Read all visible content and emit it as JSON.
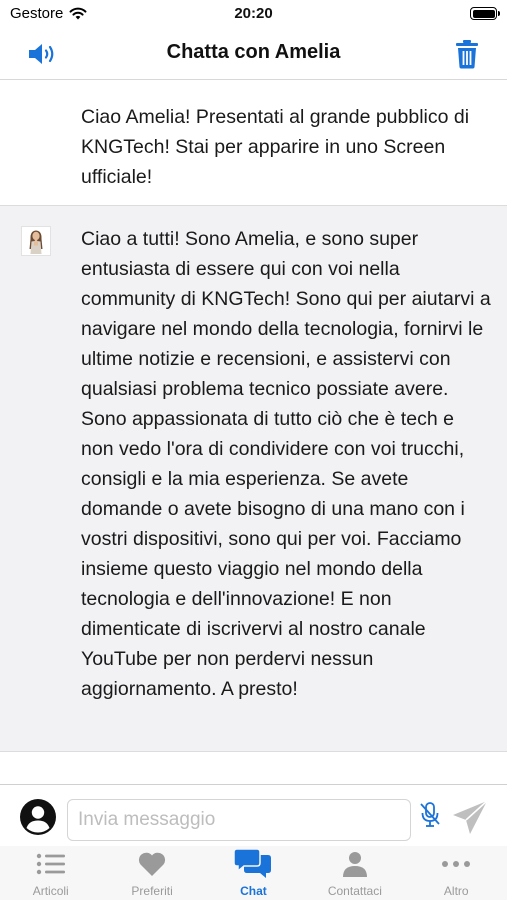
{
  "status_bar": {
    "carrier": "Gestore",
    "time": "20:20"
  },
  "header": {
    "title": "Chatta con Amelia",
    "left_icon": "speaker-icon",
    "right_icon": "trash-icon"
  },
  "colors": {
    "accent": "#1a73d9",
    "tab_inactive": "#9a9a9a",
    "bot_bubble_bg": "#f2f2f4"
  },
  "messages": [
    {
      "sender": "user",
      "text": "Ciao Amelia! Presentati al grande pubblico di KNGTech! Stai per apparire in uno Screen ufficiale!"
    },
    {
      "sender": "bot",
      "text": "Ciao a tutti! Sono Amelia, e sono super entusiasta di essere qui con voi nella community di KNGTech! Sono qui per aiutarvi a navigare nel mondo della tecnologia, fornirvi le ultime notizie e recensioni, e assistervi con qualsiasi problema tecnico possiate avere. Sono appassionata di tutto ciò che è tech e non vedo l'ora di condividere con voi trucchi, consigli e la mia esperienza. Se avete domande o avete bisogno di una mano con i vostri dispositivi, sono qui per voi. Facciamo insieme questo viaggio nel mondo della tecnologia e dell'innovazione! E non dimenticate di iscrivervi al nostro canale YouTube per non perdervi nessun aggiornamento. A presto!"
    }
  ],
  "input": {
    "value": "",
    "placeholder": "Invia messaggio"
  },
  "tabs": [
    {
      "label": "Articoli",
      "icon": "list-icon",
      "active": false
    },
    {
      "label": "Preferiti",
      "icon": "heart-icon",
      "active": false
    },
    {
      "label": "Chat",
      "icon": "chat-bubbles-icon",
      "active": true
    },
    {
      "label": "Contattaci",
      "icon": "person-icon",
      "active": false
    },
    {
      "label": "Altro",
      "icon": "more-dots-icon",
      "active": false
    }
  ]
}
